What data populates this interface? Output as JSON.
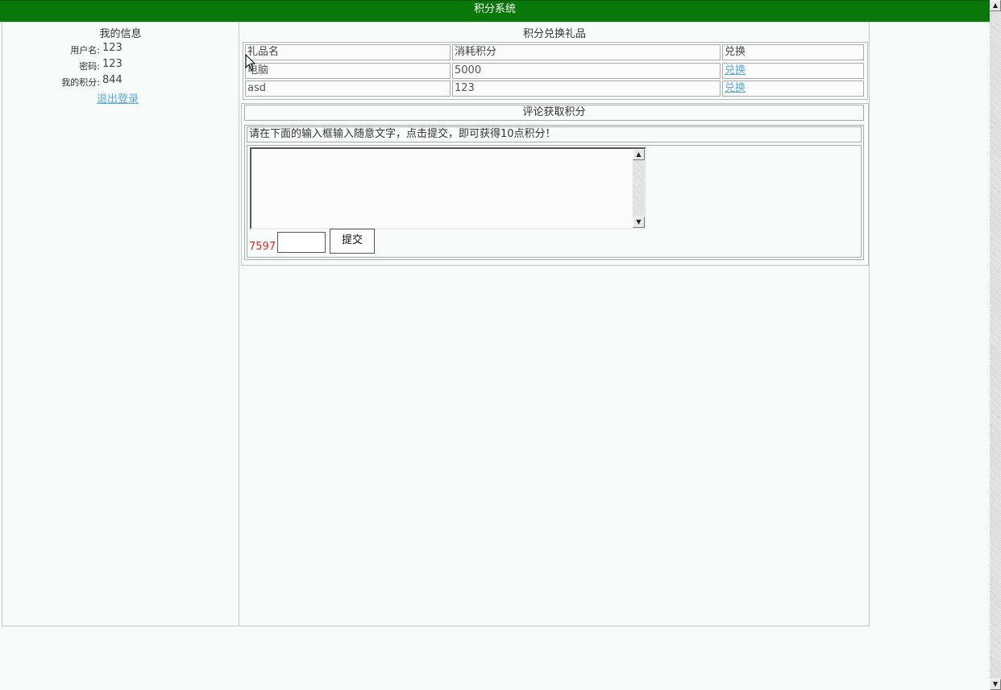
{
  "header": {
    "title": "积分系统"
  },
  "profile": {
    "title": "我的信息",
    "username_label": "用户名:",
    "username": "123",
    "password_label": "密码:",
    "password": "123",
    "points_label": "我的积分:",
    "points": "844",
    "logout": "退出登录"
  },
  "gifts": {
    "title": "积分兑换礼品",
    "headers": [
      "礼品名",
      "消耗积分",
      "兑换"
    ],
    "rows": [
      {
        "name": "电脑",
        "cost": "5000",
        "action": "兑换"
      },
      {
        "name": "asd",
        "cost": "123",
        "action": "兑换"
      }
    ]
  },
  "comment": {
    "title": "评论获取积分",
    "instruction": "请在下面的输入框输入随意文字，点击提交，即可获得10点积分！",
    "textarea_value": "",
    "captcha": "7597",
    "code_value": "",
    "submit": "提交"
  },
  "colors": {
    "header_bg": "#087808",
    "link": "#5aa8e0",
    "captcha": "#e8251f"
  }
}
